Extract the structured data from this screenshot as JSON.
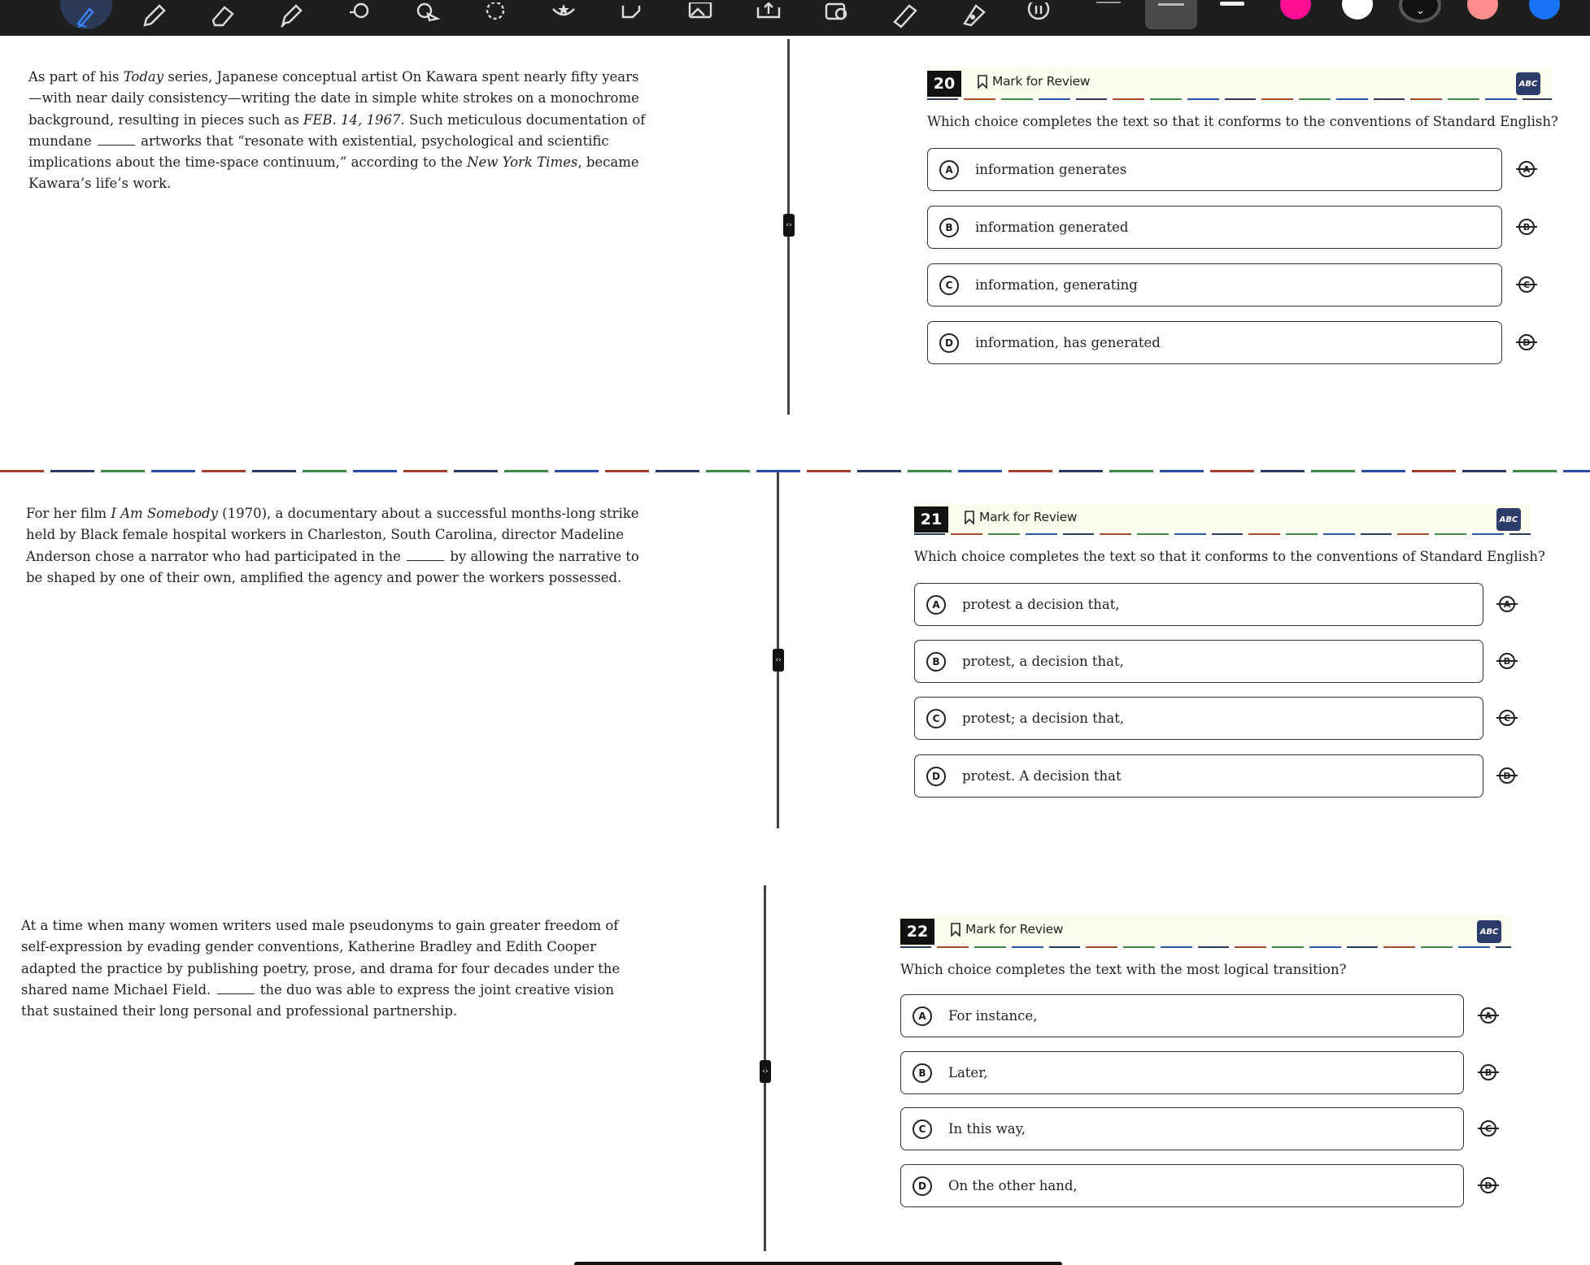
{
  "toolbar": {
    "tools": [
      "pen-tool-icon",
      "pencil-icon",
      "eraser-icon",
      "highlighter-icon",
      "lasso-icon",
      "shape-icon",
      "lasso-select-icon",
      "sticker-icon",
      "text-box-icon",
      "image-icon",
      "upload-icon",
      "camera-icon",
      "ruler-icon",
      "marker-icon",
      "audio-icon"
    ],
    "colors": {
      "magenta": "#ff0d95",
      "white": "#ffffff",
      "black": "#111111",
      "salmon": "#ff8f8f",
      "blue": "#1a72f5"
    }
  },
  "questions": [
    {
      "number": "20",
      "mark_label": "Mark for Review",
      "abc_label": "ABC",
      "passage": {
        "p1": "As part of his ",
        "i1": "Today",
        "p2": " series, Japanese conceptual artist On Kawara spent nearly fifty years—with near daily consistency—writing the date in simple white strokes on a monochrome background, resulting in pieces such as ",
        "i2": "FEB. 14, 1967",
        "p3": ". Such meticulous documentation of mundane ",
        "p4": " artworks that “resonate with existential, psychological and scientific implications about the time-space continuum,” according to the ",
        "i3": "New York Times",
        "p5": ", became Kawara’s life’s work."
      },
      "prompt": "Which choice completes the text so that it conforms to the conventions of Standard English?",
      "choices": [
        {
          "letter": "A",
          "text": "information generates"
        },
        {
          "letter": "B",
          "text": "information generated"
        },
        {
          "letter": "C",
          "text": "information, generating"
        },
        {
          "letter": "D",
          "text": "information, has generated"
        }
      ]
    },
    {
      "number": "21",
      "mark_label": "Mark for Review",
      "abc_label": "ABC",
      "passage": {
        "p1": "For her film ",
        "i1": "I Am Somebody",
        "p2": " (1970), a documentary about a successful months-long strike held by Black female hospital workers in Charleston, South Carolina, director Madeline Anderson chose a narrator who had participated in the ",
        "p3": " by allowing the narrative to be shaped by one of their own, amplified the agency and power the workers possessed."
      },
      "prompt": "Which choice completes the text so that it conforms to the conventions of Standard English?",
      "choices": [
        {
          "letter": "A",
          "text": "protest a decision that,"
        },
        {
          "letter": "B",
          "text": "protest, a decision that,"
        },
        {
          "letter": "C",
          "text": "protest; a decision that,"
        },
        {
          "letter": "D",
          "text": "protest. A decision that"
        }
      ]
    },
    {
      "number": "22",
      "mark_label": "Mark for Review",
      "abc_label": "ABC",
      "passage": {
        "p1": "At a time when many women writers used male pseudonyms to gain greater freedom of self-expression by evading gender conventions, Katherine Bradley and Edith Cooper adapted the practice by publishing poetry, prose, and drama for four decades under the shared name Michael Field. ",
        "p2": " the duo was able to express the joint creative vision that sustained their long personal and professional partnership."
      },
      "prompt": "Which choice completes the text with the most logical transition?",
      "choices": [
        {
          "letter": "A",
          "text": "For instance,"
        },
        {
          "letter": "B",
          "text": "Later,"
        },
        {
          "letter": "C",
          "text": "In this way,"
        },
        {
          "letter": "D",
          "text": "On the other hand,"
        }
      ]
    }
  ]
}
